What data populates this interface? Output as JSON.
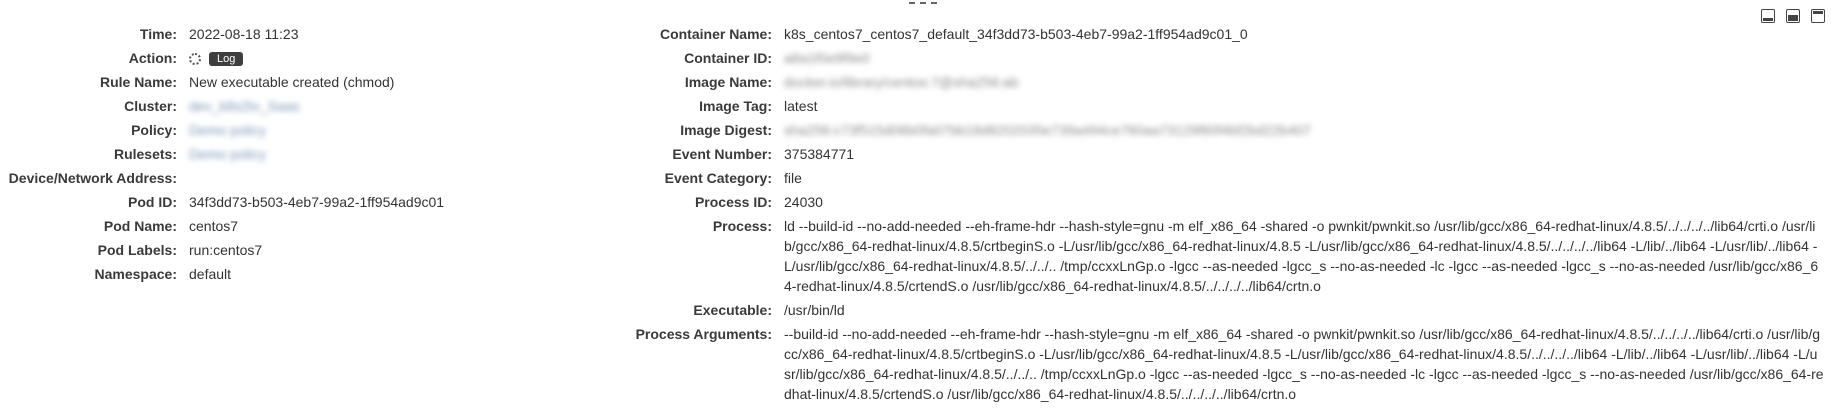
{
  "window": {
    "drag_handle_icon": "drag-handle-icon"
  },
  "left": {
    "time": {
      "label": "Time:",
      "value": "2022-08-18 11:23"
    },
    "action": {
      "label": "Action:",
      "icon": "spinner-icon",
      "button": "Log"
    },
    "rule_name": {
      "label": "Rule Name:",
      "value": "New executable created (chmod)"
    },
    "cluster": {
      "label": "Cluster:",
      "value": "dev_k8s2tv_Saas"
    },
    "policy": {
      "label": "Policy:",
      "value": "Demo policy"
    },
    "rulesets": {
      "label": "Rulesets:",
      "value": "Demo policy"
    },
    "device": {
      "label": "Device/Network Address:",
      "value": ""
    },
    "pod_id": {
      "label": "Pod ID:",
      "value": "34f3dd73-b503-4eb7-99a2-1ff954ad9c01"
    },
    "pod_name": {
      "label": "Pod Name:",
      "value": "centos7"
    },
    "pod_labels": {
      "label": "Pod Labels:",
      "value": "run:centos7"
    },
    "namespace": {
      "label": "Namespace:",
      "value": "default"
    }
  },
  "right": {
    "container_name": {
      "label": "Container Name:",
      "value": "k8s_centos7_centos7_default_34f3dd73-b503-4eb7-99a2-1ff954ad9c01_0"
    },
    "container_id": {
      "label": "Container ID:",
      "value": "a8a1f0e9f9e0"
    },
    "image_name": {
      "label": "Image Name:",
      "value": "docker.io/library/centos:7@sha256:ab"
    },
    "image_tag": {
      "label": "Image Tag:",
      "value": "latest"
    },
    "image_digest": {
      "label": "Image Digest:",
      "value": "sha256:c73f515d06b0fa07bb18d8202035e739a494ce760aa73129f60f4bf2bd22b407"
    },
    "event_number": {
      "label": "Event Number:",
      "value": "375384771"
    },
    "event_category": {
      "label": "Event Category:",
      "value": "file"
    },
    "process_id": {
      "label": "Process ID:",
      "value": "24030"
    },
    "process": {
      "label": "Process:",
      "value": "ld --build-id --no-add-needed --eh-frame-hdr --hash-style=gnu -m elf_x86_64 -shared -o pwnkit/pwnkit.so /usr/lib/gcc/x86_64-redhat-linux/4.8.5/../../../../lib64/crti.o /usr/lib/gcc/x86_64-redhat-linux/4.8.5/crtbeginS.o -L/usr/lib/gcc/x86_64-redhat-linux/4.8.5 -L/usr/lib/gcc/x86_64-redhat-linux/4.8.5/../../../../lib64 -L/lib/../lib64 -L/usr/lib/../lib64 -L/usr/lib/gcc/x86_64-redhat-linux/4.8.5/../../.. /tmp/ccxxLnGp.o -lgcc --as-needed -lgcc_s --no-as-needed -lc -lgcc --as-needed -lgcc_s --no-as-needed /usr/lib/gcc/x86_64-redhat-linux/4.8.5/crtendS.o /usr/lib/gcc/x86_64-redhat-linux/4.8.5/../../../../lib64/crtn.o"
    },
    "executable": {
      "label": "Executable:",
      "value": "/usr/bin/ld"
    },
    "process_arguments": {
      "label": "Process Arguments:",
      "value": "--build-id --no-add-needed --eh-frame-hdr --hash-style=gnu -m elf_x86_64 -shared -o pwnkit/pwnkit.so /usr/lib/gcc/x86_64-redhat-linux/4.8.5/../../../../lib64/crti.o /usr/lib/gcc/x86_64-redhat-linux/4.8.5/crtbeginS.o -L/usr/lib/gcc/x86_64-redhat-linux/4.8.5 -L/usr/lib/gcc/x86_64-redhat-linux/4.8.5/../../../../lib64 -L/lib/../lib64 -L/usr/lib/../lib64 -L/usr/lib/gcc/x86_64-redhat-linux/4.8.5/../../.. /tmp/ccxxLnGp.o -lgcc --as-needed -lgcc_s --no-as-needed -lc -lgcc --as-needed -lgcc_s --no-as-needed /usr/lib/gcc/x86_64-redhat-linux/4.8.5/crtendS.o /usr/lib/gcc/x86_64-redhat-linux/4.8.5/../../../../lib64/crtn.o"
    }
  }
}
